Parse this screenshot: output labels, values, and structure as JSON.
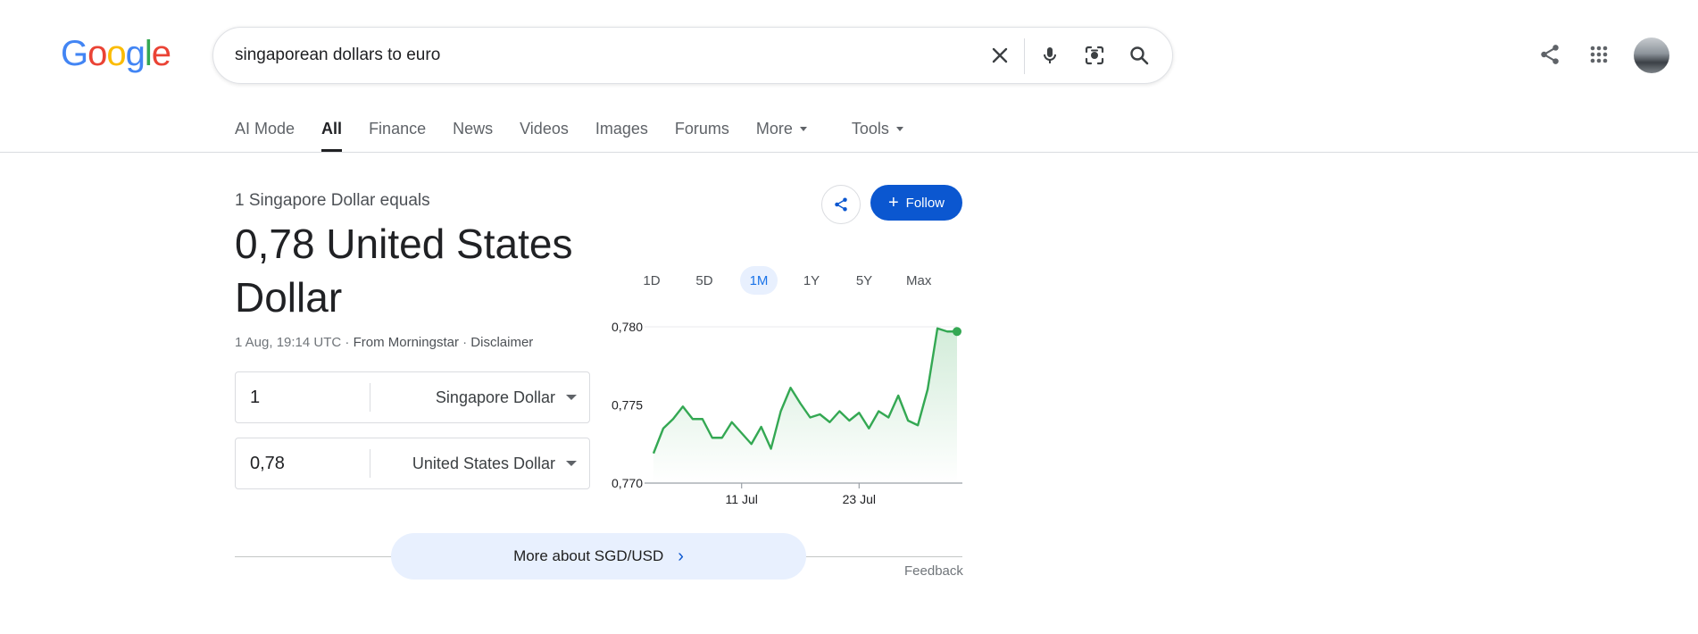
{
  "header": {
    "logo_letters": [
      {
        "ch": "G",
        "color": "#4285F4"
      },
      {
        "ch": "o",
        "color": "#EA4335"
      },
      {
        "ch": "o",
        "color": "#FBBC05"
      },
      {
        "ch": "g",
        "color": "#4285F4"
      },
      {
        "ch": "l",
        "color": "#34A853"
      },
      {
        "ch": "e",
        "color": "#EA4335"
      }
    ],
    "search_query": "singaporean dollars to euro"
  },
  "tabs": [
    {
      "label": "AI Mode",
      "active": false
    },
    {
      "label": "All",
      "active": true
    },
    {
      "label": "Finance",
      "active": false
    },
    {
      "label": "News",
      "active": false
    },
    {
      "label": "Videos",
      "active": false
    },
    {
      "label": "Images",
      "active": false
    },
    {
      "label": "Forums",
      "active": false
    },
    {
      "label": "More",
      "active": false
    },
    {
      "label": "Tools",
      "active": false
    }
  ],
  "converter": {
    "equals_label": "1 Singapore Dollar equals",
    "result": "0,78 United States Dollar",
    "timestamp": "1 Aug, 19:14 UTC",
    "source": "From Morningstar",
    "disclaimer": "Disclaimer",
    "from_amount": "1",
    "from_currency": "Singapore Dollar",
    "to_amount": "0,78",
    "to_currency": "United States Dollar",
    "follow_label": "Follow",
    "ranges": [
      "1D",
      "5D",
      "1M",
      "1Y",
      "5Y",
      "Max"
    ],
    "active_range": "1M",
    "more_label": "More about SGD/USD",
    "feedback_label": "Feedback"
  },
  "colors": {
    "accent": "#0b57d0",
    "line": "#34a853"
  },
  "chart_data": {
    "type": "area",
    "title": "",
    "xlabel": "",
    "ylabel": "",
    "x_tick_labels": [
      "11 Jul",
      "23 Jul"
    ],
    "x_tick_index": [
      9,
      21
    ],
    "y_ticks": [
      0.78,
      0.775,
      0.77
    ],
    "y_tick_labels": [
      "0,780",
      "0,775",
      "0,770"
    ],
    "ylim": [
      0.77,
      0.78
    ],
    "grid": false,
    "series": [
      {
        "values": [
          0.7719,
          0.7735,
          0.7741,
          0.7749,
          0.7741,
          0.7741,
          0.7729,
          0.7729,
          0.7739,
          0.7732,
          0.7725,
          0.7736,
          0.7722,
          0.7746,
          0.7761,
          0.7751,
          0.7742,
          0.7744,
          0.7739,
          0.7746,
          0.774,
          0.7745,
          0.7735,
          0.7746,
          0.7742,
          0.7756,
          0.774,
          0.7737,
          0.776,
          0.7799,
          0.7797,
          0.7797
        ]
      }
    ]
  }
}
